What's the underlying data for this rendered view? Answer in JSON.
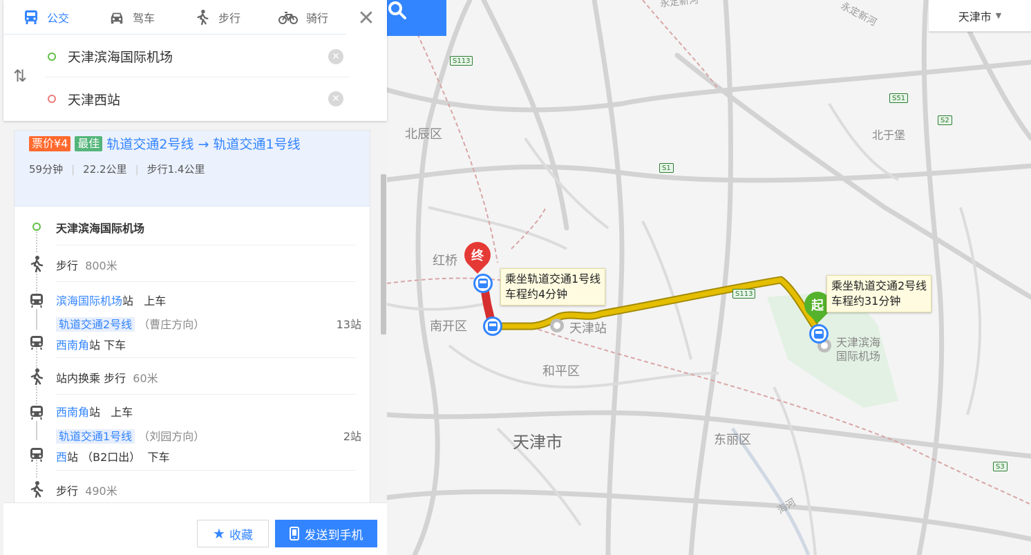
{
  "modes": [
    {
      "label": "公交",
      "icon": "bus-icon",
      "active": true
    },
    {
      "label": "驾车",
      "icon": "car-icon",
      "active": false
    },
    {
      "label": "步行",
      "icon": "walk-icon",
      "active": false
    },
    {
      "label": "骑行",
      "icon": "bike-icon",
      "active": false
    }
  ],
  "route": {
    "origin": "天津滨海国际机场",
    "destination": "天津西站"
  },
  "city": "天津市",
  "plan": {
    "price_badge": "票价¥4",
    "best_badge": "最佳",
    "title": "轨道交通2号线 → 轨道交通1号线",
    "duration": "59分钟",
    "distance": "22.2公里",
    "walk": "步行1.4公里"
  },
  "steps": {
    "start": "天津滨海国际机场",
    "walk1": {
      "label": "步行",
      "dist": "800米"
    },
    "board1": {
      "station": "滨海国际机场",
      "suffix": "站",
      "action": "上车"
    },
    "line1": {
      "name": "轨道交通2号线",
      "dir": "（曹庄方向）",
      "count": "13站"
    },
    "alight1": {
      "station": "西南角",
      "suffix": "站",
      "action": "下车"
    },
    "transfer": {
      "label": "站内换乘",
      "walk": "步行",
      "dist": "60米"
    },
    "board2": {
      "station": "西南角",
      "suffix": "站",
      "action": "上车"
    },
    "line2": {
      "name": "轨道交通1号线",
      "dir": "（刘园方向）",
      "count": "2站"
    },
    "alight2": {
      "station": "西",
      "suffix": "站",
      "exit": "（B2口出）",
      "action": "下车"
    },
    "walk2": {
      "label": "步行",
      "dist": "490米"
    }
  },
  "footer": {
    "favorite": "收藏",
    "send": "发送到手机"
  },
  "map": {
    "tooltip1": {
      "line1": "乘坐轨道交通1号线",
      "line2": "车程约4分钟"
    },
    "tooltip2": {
      "line1": "乘坐轨道交通2号线",
      "line2": "车程约31分钟"
    },
    "end_pin": "终",
    "start_pin": "起",
    "labels": {
      "beichen": "北辰区",
      "hongqiao": "红桥",
      "nankai": "南开区",
      "tianjinzhan": "天津站",
      "heping": "和平区",
      "tianjinshi": "天津市",
      "dongli": "东丽区",
      "beiyubao": "北于堡",
      "airport1": "天津滨海",
      "airport2": "国际机场",
      "yongding1": "永定新河",
      "yongding2": "永定新河",
      "haihe": "海河"
    },
    "shields": {
      "s113a": "S113",
      "s113b": "S113",
      "s51": "S51",
      "s2": "S2",
      "s1": "S1",
      "s3": "S3"
    }
  },
  "colors": {
    "accent": "#3385ff",
    "price": "#ff6a2e",
    "best": "#54b57a",
    "route_yellow": "#e4be00",
    "route_red": "#d62f2f"
  }
}
